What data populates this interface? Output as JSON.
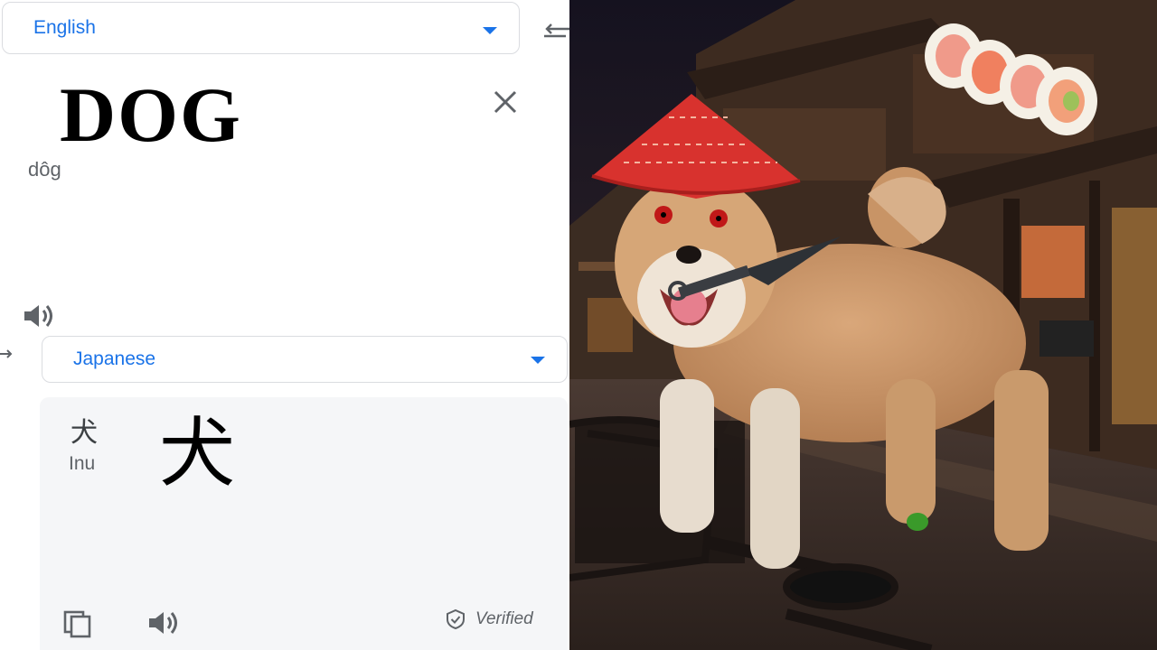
{
  "source": {
    "language": "English",
    "text": "DOG",
    "transliteration": "dôg"
  },
  "target": {
    "language": "Japanese",
    "small_text": "犬",
    "transliteration": "Inu",
    "translation": "犬",
    "verified_label": "Verified"
  },
  "colors": {
    "accent": "#1a73e8",
    "result_bg": "#f5f6f8",
    "hat": "#d8322e",
    "sky": "#1c1828"
  },
  "icons": [
    "swap-icon",
    "clear-icon",
    "speaker-icon",
    "copy-icon",
    "verified-shield-icon",
    "chevron-down-icon"
  ]
}
